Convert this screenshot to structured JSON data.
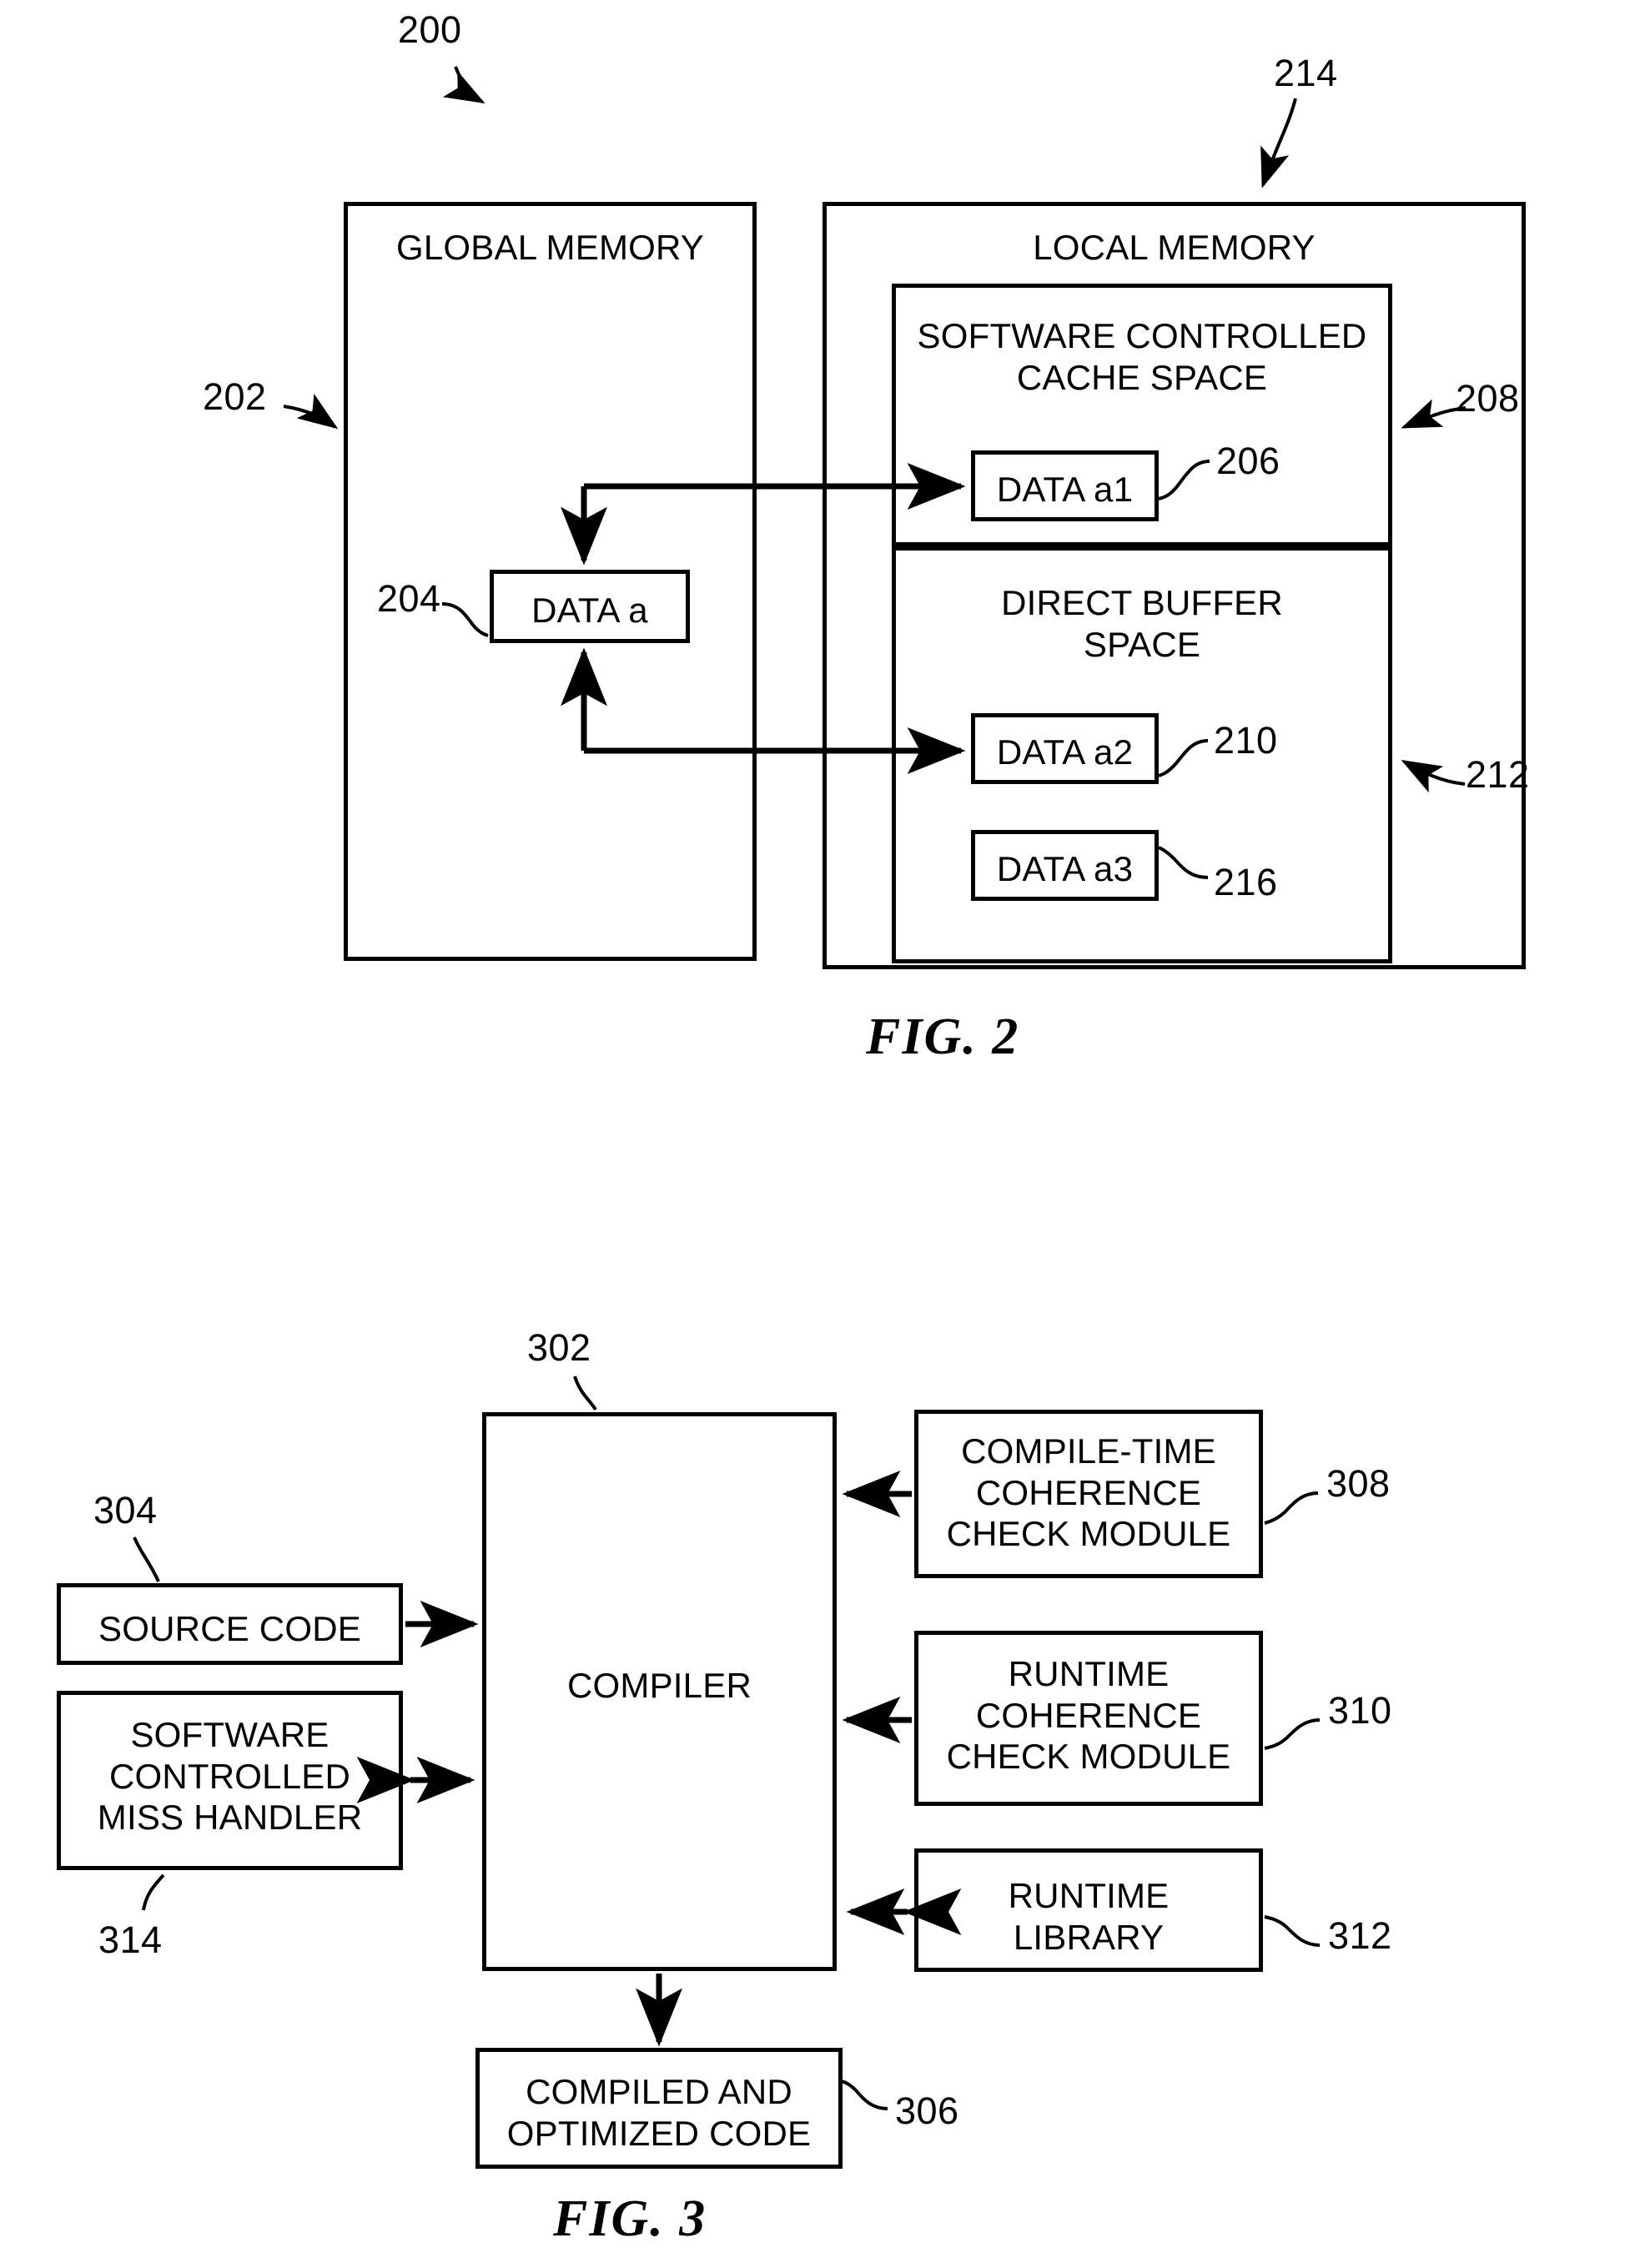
{
  "document": {
    "type": "patent-drawing-sheet",
    "figures": [
      "FIG. 2",
      "FIG. 3"
    ]
  },
  "figure2": {
    "caption": "FIG. 2",
    "system_ref": "200",
    "global_memory": {
      "title": "GLOBAL MEMORY",
      "ref": "202",
      "data_block": {
        "label": "DATA a",
        "ref": "204"
      }
    },
    "local_memory": {
      "title": "LOCAL MEMORY",
      "ref": "214",
      "cache_space": {
        "title": "SOFTWARE CONTROLLED\nCACHE SPACE",
        "ref": "208",
        "data_block": {
          "label": "DATA a1",
          "ref": "206"
        }
      },
      "buffer_space": {
        "title": "DIRECT BUFFER\nSPACE",
        "ref": "212",
        "data_blocks": [
          {
            "label": "DATA a2",
            "ref": "210"
          },
          {
            "label": "DATA a3",
            "ref": "216"
          }
        ]
      }
    }
  },
  "figure3": {
    "caption": "FIG. 3",
    "compiler": {
      "label": "COMPILER",
      "ref": "302"
    },
    "inputs": [
      {
        "label": "SOURCE CODE",
        "ref": "304"
      },
      {
        "label": "SOFTWARE\nCONTROLLED\nMISS HANDLER",
        "ref": "314"
      }
    ],
    "modules": [
      {
        "label": "COMPILE-TIME\nCOHERENCE\nCHECK MODULE",
        "ref": "308"
      },
      {
        "label": "RUNTIME\nCOHERENCE\nCHECK MODULE",
        "ref": "310"
      },
      {
        "label": "RUNTIME\nLIBRARY",
        "ref": "312"
      }
    ],
    "output": {
      "label": "COMPILED AND\nOPTIMIZED CODE",
      "ref": "306"
    }
  }
}
